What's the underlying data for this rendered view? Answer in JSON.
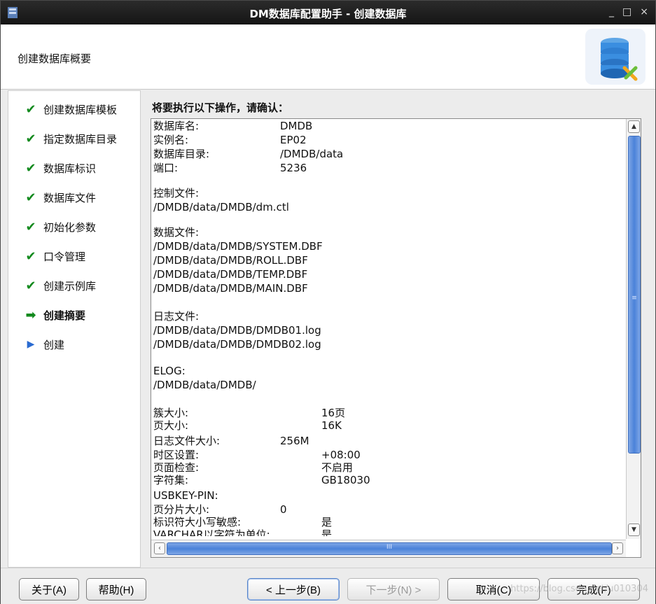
{
  "window": {
    "title": "DM数据库配置助手 - 创建数据库",
    "controls": [
      "_",
      "□",
      "×"
    ]
  },
  "header": {
    "title": "创建数据库概要"
  },
  "steps": [
    {
      "label": "创建数据库模板",
      "state": "done"
    },
    {
      "label": "指定数据库目录",
      "state": "done"
    },
    {
      "label": "数据库标识",
      "state": "done"
    },
    {
      "label": "数据库文件",
      "state": "done"
    },
    {
      "label": "初始化参数",
      "state": "done"
    },
    {
      "label": "口令管理",
      "state": "done"
    },
    {
      "label": "创建示例库",
      "state": "done"
    },
    {
      "label": "创建摘要",
      "state": "current"
    },
    {
      "label": "创建",
      "state": "pending"
    }
  ],
  "summary": {
    "prompt": "将要执行以下操作，请确认：",
    "db_name_label": "数据库名:",
    "db_name": "DMDB",
    "instance_label": "实例名:",
    "instance": "EP02",
    "db_dir_label": "数据库目录:",
    "db_dir": "/DMDB/data",
    "port_label": "端口:",
    "port": "5236",
    "control_label": "控制文件:",
    "control_file": "/DMDB/data/DMDB/dm.ctl",
    "datafile_label": "数据文件:",
    "datafiles": [
      "/DMDB/data/DMDB/SYSTEM.DBF",
      "/DMDB/data/DMDB/ROLL.DBF",
      "/DMDB/data/DMDB/TEMP.DBF",
      "/DMDB/data/DMDB/MAIN.DBF"
    ],
    "log_label": "日志文件:",
    "logs": [
      "/DMDB/data/DMDB/DMDB01.log",
      "/DMDB/data/DMDB/DMDB02.log"
    ],
    "elog_label": "ELOG:",
    "elog": "/DMDB/data/DMDB/",
    "extent_label": "簇大小:",
    "extent": "16页",
    "page_label": "页大小:",
    "page": "16K",
    "logsize_label": "日志文件大小:",
    "logsize": "256M",
    "tz_label": "时区设置:",
    "tz": "+08:00",
    "pagecheck_label": "页面检查:",
    "pagecheck": "不启用",
    "charset_label": "字符集:",
    "charset": "GB18030",
    "usbkey_label": "USBKEY-PIN:",
    "partition_label": "页分片大小:",
    "partition": "0",
    "case_label": "标识符大小写敏感:",
    "case": "是",
    "varchar_label": "VARCHAR以字符为单位:",
    "varchar": "是"
  },
  "buttons": {
    "about": "关于(A)",
    "help": "帮助(H)",
    "prev": "< 上一步(B)",
    "next": "下一步(N) >",
    "cancel": "取消(C)",
    "finish": "完成(F)"
  },
  "watermark": "https://blog.csdn.net/u010304"
}
